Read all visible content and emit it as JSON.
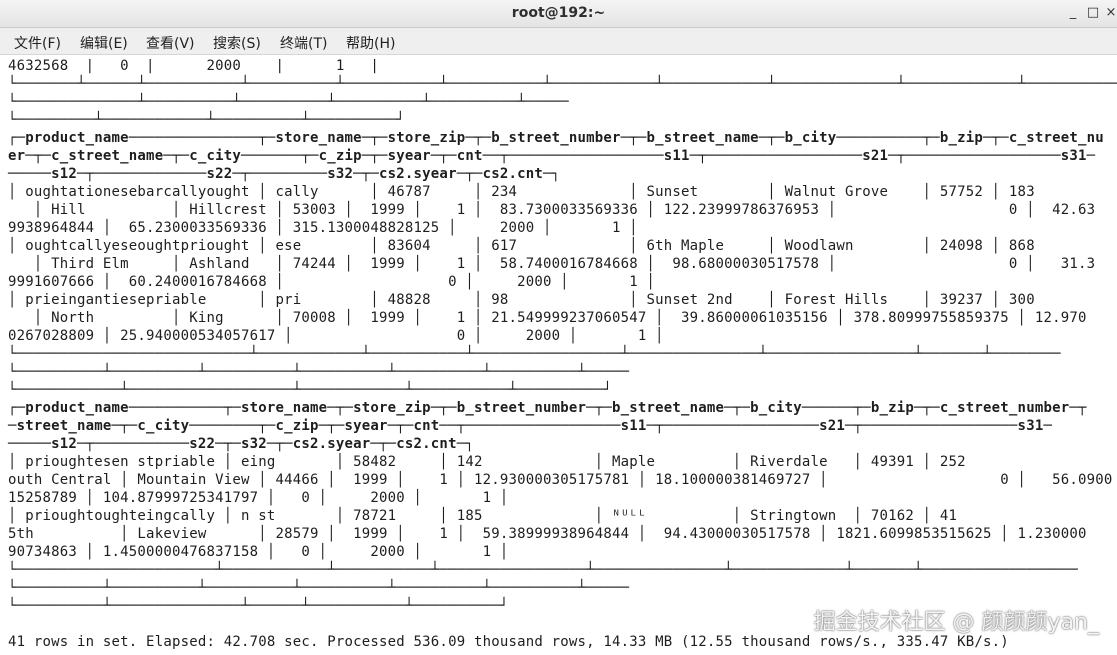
{
  "window": {
    "title": "root@192:~",
    "minimize_glyph": "_",
    "maximize_glyph": "□",
    "close_glyph": "×"
  },
  "menu": {
    "items": [
      "文件(F)",
      "编辑(E)",
      "查看(V)",
      "搜索(S)",
      "终端(T)",
      "帮助(H)"
    ]
  },
  "terminal": {
    "lines": [
      {
        "text": "4632568  |   0  |      2000    |      1   |",
        "bold": false
      },
      {
        "text": "└───────┴──────┴───────────┴──────────┴───────────┴───────────┴────────────┴────────────┴──────────────┴─────────────┴─────────────┴──────────────────┘",
        "bold": false
      },
      {
        "text": "└──────────────┴──────────┴──────────┴──────────┴──────────┴─────",
        "bold": false
      },
      {
        "text": "└─────────┴────────────┴──────────┴──────────┘",
        "bold": false
      },
      {
        "text": "┌─product_name───────────────┬─store_name─┬─store_zip─┬─b_street_number─┬─b_street_name─┬─b_city──────────┬─b_zip─┬─c_street_nu",
        "bold": true
      },
      {
        "text": "er─┬─c_street_name─┬─c_city───────┬─c_zip─┬─syear─┬─cnt──┬──────────────────s11─┬──────────────────s21─┬──────────────────s31─",
        "bold": true
      },
      {
        "text": "─────s12─┬─────────────s22─┬─────────s32─┬─cs2.syear─┬─cs2.cnt─┐",
        "bold": true
      },
      {
        "text": "│ oughtationesebarcallyought │ cally      │ 46787     │ 234             │ Sunset        │ Walnut Grove    │ 57752 │ 183",
        "bold": false
      },
      {
        "text": "   │ Hill          │ Hillcrest │ 53003 │  1999 │    1 │  83.7300033569336 │ 122.23999786376953 │                    0 │  42.63",
        "bold": false
      },
      {
        "text": "9938964844 │  65.2300033569336 │ 315.1300048828125 │     2000 │       1 │",
        "bold": false
      },
      {
        "text": "│ oughtcallyeseoughtpriought │ ese        │ 83604     │ 617             │ 6th Maple     │ Woodlawn        │ 24098 │ 868",
        "bold": false
      },
      {
        "text": "   │ Third Elm     │ Ashland   │ 74244 │  1999 │    1 │  58.7400016784668 │  98.68000030517578 │                    0 │   31.3",
        "bold": false
      },
      {
        "text": "9991607666 │  60.2400016784668 │                   0 │     2000 │       1 │",
        "bold": false
      },
      {
        "text": "│ prieingantiesepriable      │ pri        │ 48828     │ 98              │ Sunset 2nd    │ Forest Hills    │ 39237 │ 300",
        "bold": false
      },
      {
        "text": "   │ North         │ King      │ 70008 │  1999 │    1 │ 21.549999237060547 │  39.86000061035156 │ 378.80999755859375 │ 12.970",
        "bold": false
      },
      {
        "text": "0267028809 │ 25.940000534057617 │                   0 │     2000 │       1 │",
        "bold": false
      },
      {
        "text": "└───────────────────────────┴────────────┴───────────┴─────────────────┴───────────────┴─────────────────┴───────┴────────",
        "bold": false
      },
      {
        "text": "└──────────┴──────────┴──────────┴──────────┴──────────┴──────────┴─────",
        "bold": false
      },
      {
        "text": "└────────────┴───────────────────┴────────────┴───────────┴──────────┘",
        "bold": false
      },
      {
        "text": "┌─product_name───────────┬─store_name─┬─store_zip─┬─b_street_number─┬─b_street_name─┬─b_city──────┬─b_zip─┬─c_street_number─┬",
        "bold": true
      },
      {
        "text": "─street_name─┬─c_city────────┬─c_zip─┬─syear─┬─cnt──┬──────────────────s11─┬──────────────────s21─┬──────────────────s31─",
        "bold": true
      },
      {
        "text": "─────s12─┬───────────s22─┬─s32─┬─cs2.syear─┬─cs2.cnt─┐",
        "bold": true
      },
      {
        "text": "│ prioughtesen stpriable │ eing       │ 58482     │ 142             │ Maple         │ Riverdale   │ 49391 │ 252",
        "bold": false
      },
      {
        "text": "outh Central │ Mountain View │ 44466 │  1999 │    1 │ 12.930000305175781 │ 18.100000381469727 │                    0 │   56.0900",
        "bold": false
      },
      {
        "text": "15258789 │ 104.87999725341797 │   0 │     2000 │       1 │",
        "bold": false
      },
      {
        "text": "│ prioughtoughteingcally │ n st       │ 78721     │ 185             │ ᴺᵁᴸᴸ          │ Stringtown  │ 70162 │ 41",
        "bold": false
      },
      {
        "text": "5th          │ Lakeview      │ 28579 │  1999 │    1 │  59.38999938964844 │  94.43000030517578 │ 1821.6099853515625 │ 1.230000",
        "bold": false
      },
      {
        "text": "90734863 │ 1.4500000476837158 │   0 │     2000 │       1 │",
        "bold": false
      },
      {
        "text": "└───────────────────────┴────────────┴───────────┴─────────────────┴───────────────┴─────────────┴───────┴──────────────────",
        "bold": false
      },
      {
        "text": "└──────────┴──────────┴──────────┴──────────┴──────────┴──────────┴─────",
        "bold": false
      },
      {
        "text": "└──────────┴───────────────┴──────┴───────────┴──────────┘",
        "bold": false
      },
      {
        "text": "",
        "bold": false
      },
      {
        "text": "41 rows in set. Elapsed: 42.708 sec. Processed 536.09 thousand rows, 14.33 MB (12.55 thousand rows/s., 335.47 KB/s.)",
        "bold": false
      }
    ]
  },
  "watermark": "掘金技术社区 @ 颜颜颜yan_"
}
